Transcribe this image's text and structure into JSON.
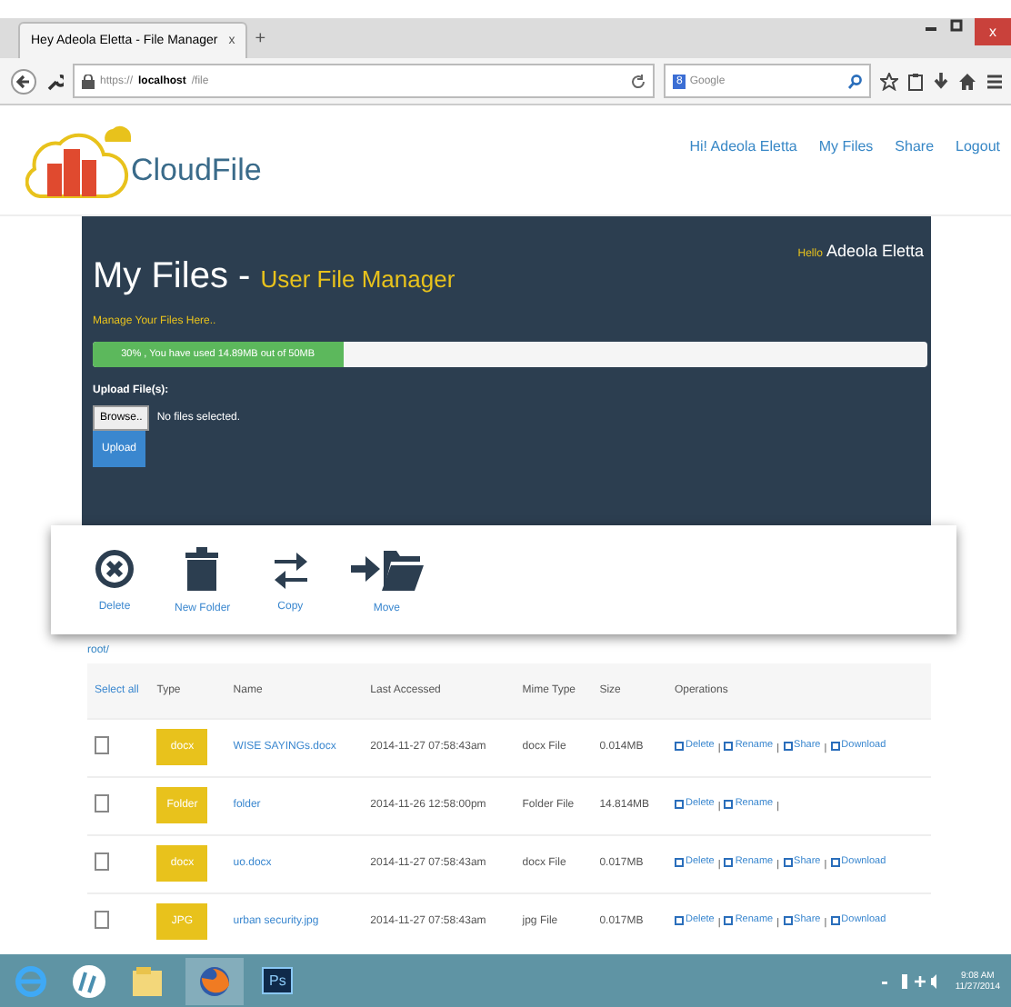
{
  "browser": {
    "tab_title": "Hey Adeola Eletta - File Manager",
    "tab_close": "x",
    "new_tab": "+",
    "url_prefix": "https://",
    "url_host": "localhost",
    "url_path": "/file",
    "search_engine": "8",
    "search_placeholder": "Google",
    "close_button": "x"
  },
  "site": {
    "logo": "CloudFile",
    "nav": [
      {
        "label": "Hi! Adeola Eletta"
      },
      {
        "label": "My Files"
      },
      {
        "label": "Share"
      },
      {
        "label": "Logout"
      }
    ]
  },
  "panel": {
    "title": "My Files - ",
    "subtitle": "User File Manager",
    "greeting_prefix": "Hello",
    "greeting_name": "Adeola Eletta",
    "tagline": "Manage Your Files Here..",
    "usage": {
      "level": 0.3,
      "label": "30% , You have used 14.89MB out of 50MB"
    },
    "upload_label": "Upload File(s):",
    "browse_button": "Browse..",
    "file_status": "No files selected.",
    "upload_button": "Upload"
  },
  "toolbar": [
    {
      "kind": "delete",
      "label": "Delete"
    },
    {
      "kind": "folder",
      "label": "New Folder"
    },
    {
      "kind": "copy",
      "label": "Copy"
    },
    {
      "kind": "move",
      "label": "Move"
    }
  ],
  "table": {
    "path": "root/",
    "op_separator": "|",
    "columns": [
      "Select all",
      "Type",
      "Name",
      "Last Accessed",
      "Mime Type",
      "Size",
      "Operations"
    ],
    "rows": [
      {
        "checked": false,
        "type": "docx",
        "name": "WISE SAYINGs.docx",
        "accessed": "2014-11-27 07:58:43am",
        "mime": "docx File",
        "size": "0.014MB",
        "ops": [
          "Delete",
          "Rename",
          "Share",
          "Download"
        ]
      },
      {
        "checked": false,
        "type": "Folder",
        "name": "folder",
        "accessed": "2014-11-26 12:58:00pm",
        "mime": "Folder File",
        "size": "14.814MB",
        "ops": [
          "Delete",
          "Rename"
        ],
        "trailing_separator": true
      },
      {
        "checked": false,
        "type": "docx",
        "name": "uo.docx",
        "accessed": "2014-11-27 07:58:43am",
        "mime": "docx File",
        "size": "0.017MB",
        "ops": [
          "Delete",
          "Rename",
          "Share",
          "Download"
        ]
      },
      {
        "checked": false,
        "type": "JPG",
        "name": "urban security.jpg",
        "accessed": "2014-11-27 07:58:43am",
        "mime": "jpg File",
        "size": "0.017MB",
        "ops": [
          "Delete",
          "Rename",
          "Share",
          "Download"
        ]
      }
    ]
  },
  "taskbar": {
    "apps": [
      {
        "kind": "ie"
      },
      {
        "kind": "hp"
      },
      {
        "kind": "explorer"
      },
      {
        "kind": "firefox",
        "selected": true
      },
      {
        "kind": "ps",
        "label": "Ps"
      }
    ],
    "time": "9:08 AM",
    "date": "11/27/2014"
  }
}
